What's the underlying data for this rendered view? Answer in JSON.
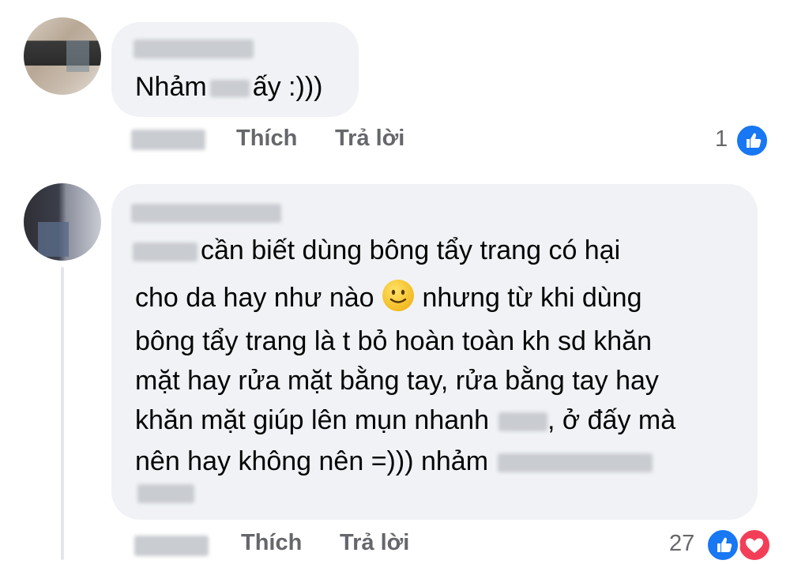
{
  "comment1": {
    "text_before": "Nhảm",
    "text_after": "ấy :)))",
    "actions": {
      "like": "Thích",
      "reply": "Trả lời"
    },
    "reaction_count": "1",
    "reaction_icons": [
      "like-icon"
    ]
  },
  "comment2": {
    "lines": {
      "l1_after": "cần biết dùng bông tẩy trang có hại",
      "l2_before": "cho da hay như nào",
      "l2_after": "nhưng từ khi dùng",
      "l3": "bông tẩy trang là t bỏ hoàn toàn kh sd khăn",
      "l4": "mặt hay rửa mặt bằng tay, rửa bằng tay hay",
      "l5_before": "khăn mặt giúp lên mụn nhanh",
      "l5_after": ", ở đấy mà",
      "l6_before": "nên hay không nên =))) nhảm"
    },
    "emoji": "slightly-smiling-face-emoji",
    "actions": {
      "like": "Thích",
      "reply": "Trả lời"
    },
    "reaction_count": "27",
    "reaction_icons": [
      "like-icon",
      "love-icon"
    ]
  },
  "colors": {
    "bubble": "#f0f2f5",
    "meta_text": "#65676b",
    "like_blue": "#1877f2",
    "love_red": "#f33e58"
  }
}
